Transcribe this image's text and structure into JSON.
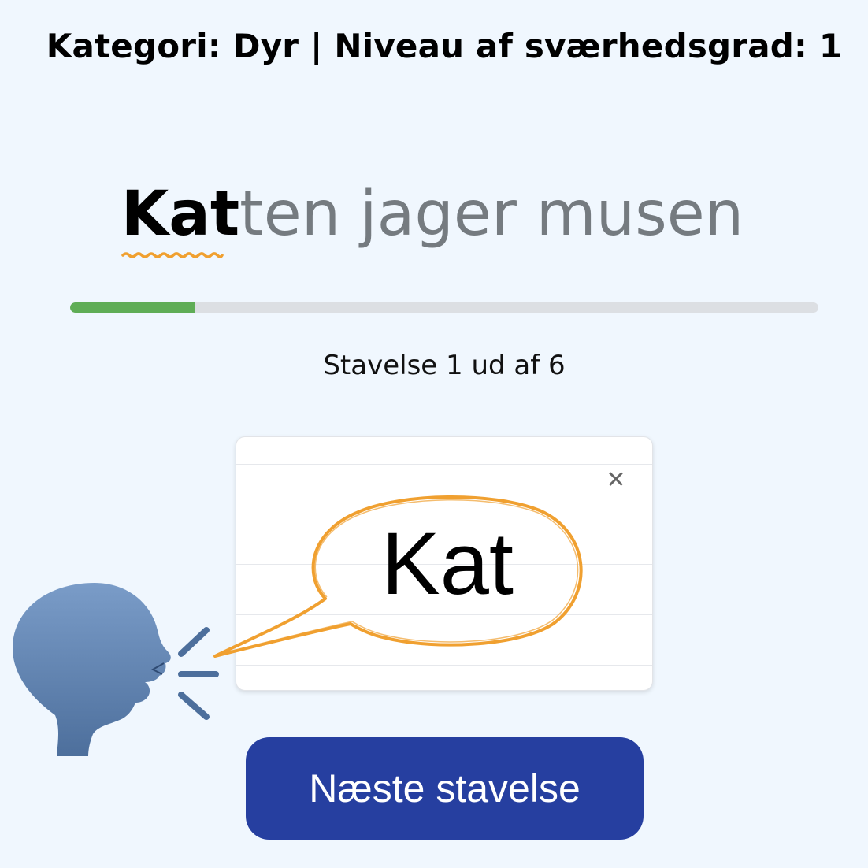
{
  "header": {
    "title": "Kategori: Dyr | Niveau af sværhedsgrad: 1"
  },
  "sentence": {
    "active_syllable": "Kat",
    "remaining_text": "ten jager musen"
  },
  "progress": {
    "fraction": 0.1667,
    "fill_color": "#5fad56",
    "label": "Stavelse 1 ud af 6"
  },
  "card": {
    "syllable": "Kat",
    "close_icon": "close-icon",
    "close_symbol": "✕"
  },
  "speaker": {
    "icon": "speaking-head-icon"
  },
  "actions": {
    "next_label": "Næste stavelse"
  },
  "colors": {
    "accent_orange": "#f0a030",
    "button_blue": "#263fa0",
    "background": "#f0f7fe"
  }
}
